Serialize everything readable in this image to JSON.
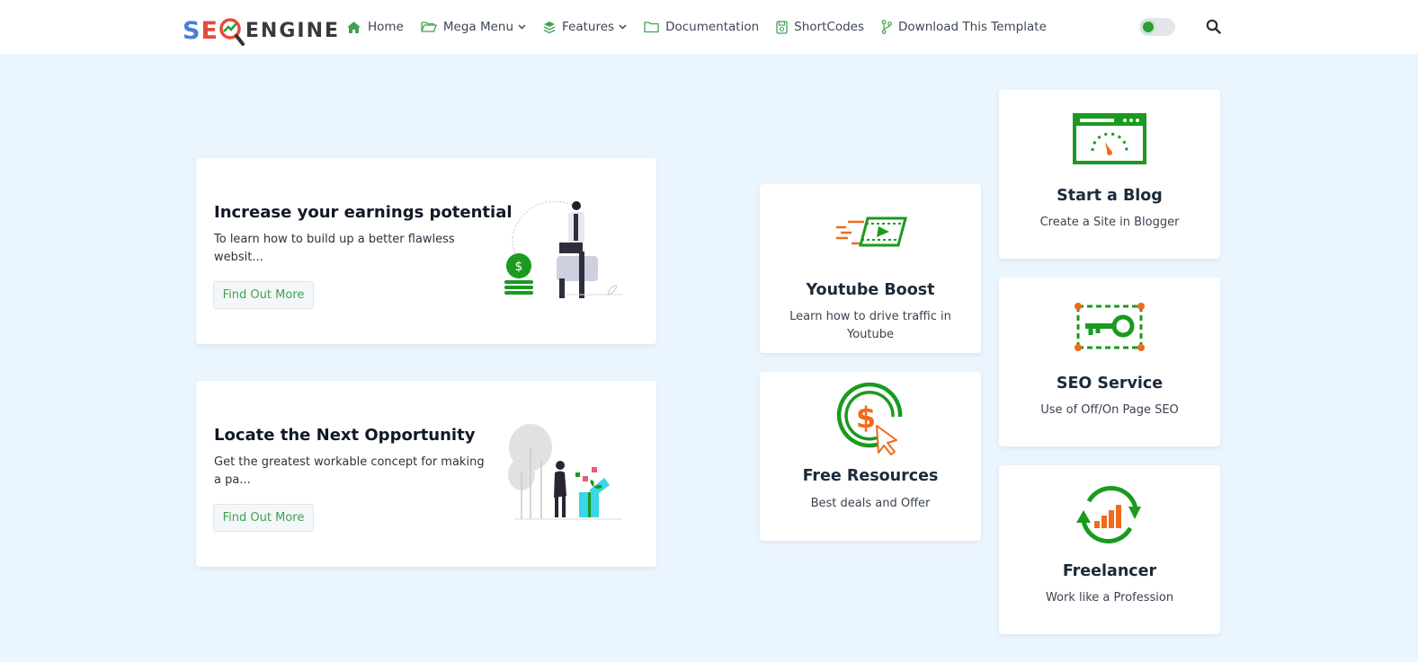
{
  "brand": {
    "logo_start": "SE",
    "logo_end": "ENGINE"
  },
  "nav": {
    "items": [
      {
        "label": "Home",
        "icon": "home-icon"
      },
      {
        "label": "Mega Menu",
        "icon": "folder-open-icon",
        "dropdown": true
      },
      {
        "label": "Features",
        "icon": "layers-icon",
        "dropdown": true
      },
      {
        "label": "Documentation",
        "icon": "folder-icon"
      },
      {
        "label": "ShortCodes",
        "icon": "code-file-icon"
      },
      {
        "label": "Download This Template",
        "icon": "git-branch-icon"
      }
    ]
  },
  "controls": {
    "theme_toggle": "dark-mode-toggle",
    "search_icon": "search-icon"
  },
  "promos": [
    {
      "title": "Increase your earnings potential",
      "description": "To learn how to build up a better flawless websit...",
      "button": "Find Out More"
    },
    {
      "title": "Locate the Next Opportunity",
      "description": "Get the greatest workable concept for making a pa...",
      "button": "Find Out More"
    }
  ],
  "services": [
    {
      "name": "Youtube Boost",
      "description": "Learn how to drive traffic in Youtube",
      "icon": "video-boost-icon"
    },
    {
      "name": "Free Resources",
      "description": "Best deals and Offer",
      "icon": "dollar-click-icon"
    },
    {
      "name": "Start a Blog",
      "description": "Create a Site in Blogger",
      "icon": "speedometer-browser-icon"
    },
    {
      "name": "SEO Service",
      "description": "Use of Off/On Page SEO",
      "icon": "key-frame-icon"
    },
    {
      "name": "Freelancer",
      "description": "Work like a Profession",
      "icon": "growth-chart-icon"
    }
  ],
  "colors": {
    "accent": "#1a9a1f",
    "accent_orange": "#f26a1b",
    "background": "#ebf5fe",
    "button_text": "#3fa34d"
  }
}
